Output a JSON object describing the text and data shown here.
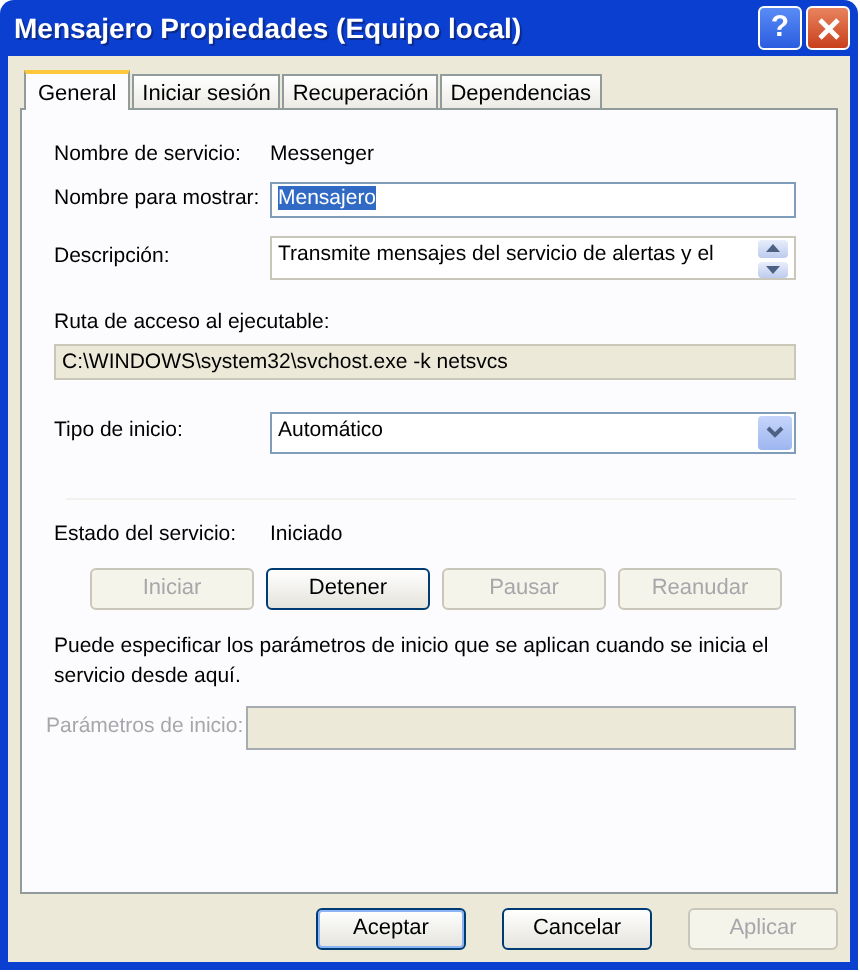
{
  "window": {
    "title": "Mensajero Propiedades (Equipo local)",
    "title_buttons": [
      {
        "kind": "help",
        "label": "?"
      },
      {
        "kind": "close"
      }
    ]
  },
  "tabs": [
    {
      "label": "General",
      "selected": true
    },
    {
      "label": "Iniciar sesión",
      "selected": false
    },
    {
      "label": "Recuperación",
      "selected": false
    },
    {
      "label": "Dependencias",
      "selected": false
    }
  ],
  "service_name": {
    "label": "Nombre de servicio:",
    "value": "Messenger"
  },
  "display_name": {
    "label": "Nombre para mostrar:",
    "value": "Mensajero",
    "highlighted": true
  },
  "description": {
    "label": "Descripción:",
    "value": "Transmite mensajes del servicio de alertas y el"
  },
  "executable_path": {
    "label": "Ruta de acceso al ejecutable:",
    "value": "C:\\WINDOWS\\system32\\svchost.exe -k netsvcs",
    "read_only": true
  },
  "startup_type": {
    "label": "Tipo de inicio:",
    "value": "Automático"
  },
  "service_status": {
    "label": "Estado del servicio:",
    "value": "Iniciado"
  },
  "service_buttons": [
    {
      "label": "Iniciar",
      "disabled": true
    },
    {
      "label": "Detener",
      "disabled": false
    },
    {
      "label": "Pausar",
      "disabled": true
    },
    {
      "label": "Reanudar",
      "disabled": true
    }
  ],
  "hint": "Puede especificar los parámetros de inicio que se aplican cuando se inicia el servicio desde aquí.",
  "start_parameters": {
    "label": "Parámetros de inicio:",
    "disabled": true
  },
  "dialog_buttons": [
    {
      "label": "Aceptar",
      "default": true,
      "disabled": false
    },
    {
      "label": "Cancelar",
      "default": false,
      "disabled": false
    },
    {
      "label": "Aplicar",
      "default": false,
      "disabled": true
    }
  ]
}
